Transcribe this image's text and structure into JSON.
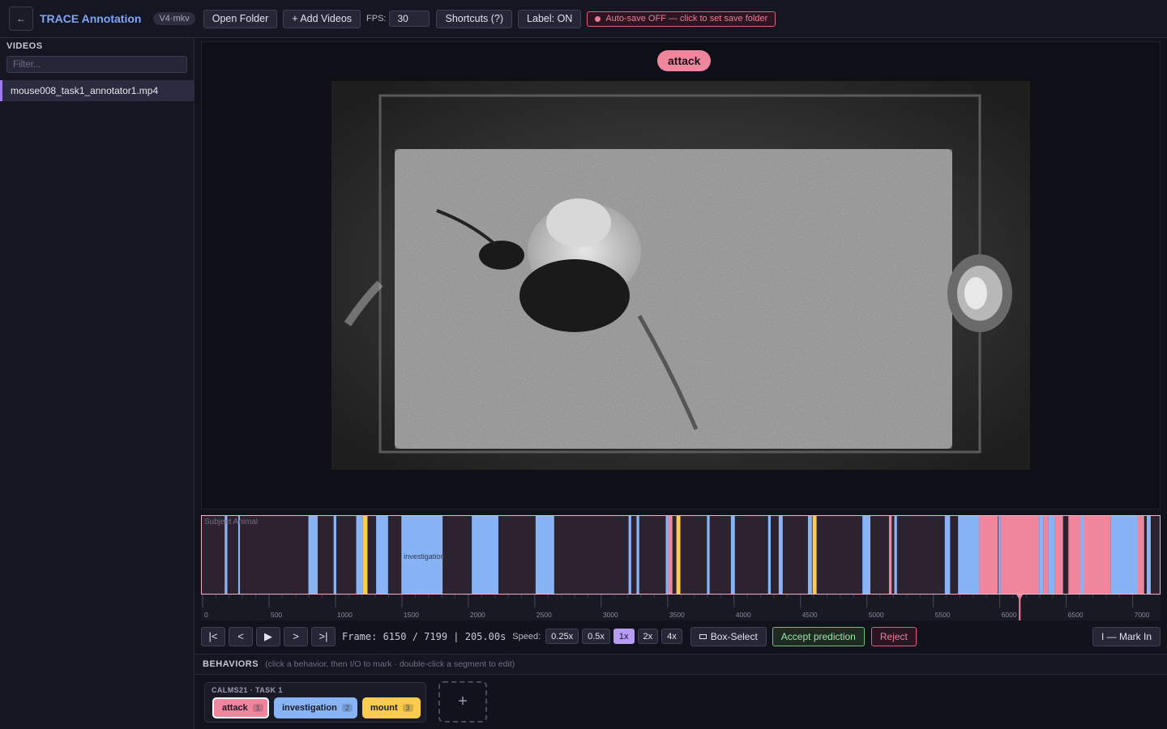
{
  "header": {
    "back_icon": "arrow-left-icon",
    "title": "TRACE Annotation",
    "version": "V4·mkv",
    "open_folder": "Open Folder",
    "add_videos": "+ Add Videos",
    "fps_label": "FPS:",
    "fps_value": "30",
    "shortcuts": "Shortcuts (?)",
    "label_toggle": "Label: ON",
    "autosave": "Auto-save OFF — click to set save folder"
  },
  "sidebar": {
    "heading": "VIDEOS",
    "filter_placeholder": "Filter...",
    "videos": [
      "mouse008_task1_annotator1.mp4"
    ]
  },
  "viewer": {
    "current_behavior": "attack"
  },
  "timeline": {
    "track_label": "Subject Animal",
    "total_frames": 7199,
    "current_frame": 6150,
    "segment_text": "investigation",
    "tick_labels": [
      "0",
      "500",
      "1000",
      "1500",
      "2000",
      "2500",
      "3000",
      "3500",
      "4000",
      "4500",
      "5000",
      "5500",
      "6000",
      "6500",
      "7000"
    ],
    "colors": {
      "attack": "#f0859e",
      "investigation": "#88b4f5",
      "mount": "#fbcb4e",
      "background": "#2c2230"
    },
    "segments": [
      {
        "b": "investigation",
        "s": 160,
        "e": 180
      },
      {
        "b": "investigation",
        "s": 262,
        "e": 275
      },
      {
        "b": "investigation",
        "s": 790,
        "e": 860
      },
      {
        "b": "investigation",
        "s": 980,
        "e": 1000
      },
      {
        "b": "investigation",
        "s": 1150,
        "e": 1200
      },
      {
        "b": "mount",
        "s": 1200,
        "e": 1235
      },
      {
        "b": "investigation",
        "s": 1300,
        "e": 1390
      },
      {
        "b": "investigation",
        "s": 1490,
        "e": 1800
      },
      {
        "b": "investigation",
        "s": 2020,
        "e": 2220
      },
      {
        "b": "investigation",
        "s": 2500,
        "e": 2640
      },
      {
        "b": "investigation",
        "s": 3200,
        "e": 3220
      },
      {
        "b": "investigation",
        "s": 3260,
        "e": 3280
      },
      {
        "b": "investigation",
        "s": 3480,
        "e": 3500
      },
      {
        "b": "attack",
        "s": 3500,
        "e": 3530
      },
      {
        "b": "mount",
        "s": 3560,
        "e": 3590
      },
      {
        "b": "investigation",
        "s": 3790,
        "e": 3810
      },
      {
        "b": "investigation",
        "s": 3970,
        "e": 4000
      },
      {
        "b": "investigation",
        "s": 4250,
        "e": 4270
      },
      {
        "b": "investigation",
        "s": 4330,
        "e": 4360
      },
      {
        "b": "investigation",
        "s": 4550,
        "e": 4580
      },
      {
        "b": "mount",
        "s": 4585,
        "e": 4615
      },
      {
        "b": "investigation",
        "s": 4960,
        "e": 5020
      },
      {
        "b": "attack",
        "s": 5160,
        "e": 5180
      },
      {
        "b": "investigation",
        "s": 5200,
        "e": 5220
      },
      {
        "b": "investigation",
        "s": 5580,
        "e": 5620
      },
      {
        "b": "investigation",
        "s": 5680,
        "e": 5840
      },
      {
        "b": "attack",
        "s": 5840,
        "e": 5980
      },
      {
        "b": "investigation",
        "s": 5985,
        "e": 6000
      },
      {
        "b": "attack",
        "s": 6000,
        "e": 6290
      },
      {
        "b": "investigation",
        "s": 6290,
        "e": 6320
      },
      {
        "b": "attack",
        "s": 6320,
        "e": 6360
      },
      {
        "b": "investigation",
        "s": 6360,
        "e": 6410
      },
      {
        "b": "attack",
        "s": 6410,
        "e": 6470
      },
      {
        "b": "attack",
        "s": 6510,
        "e": 6600
      },
      {
        "b": "investigation",
        "s": 6600,
        "e": 6630
      },
      {
        "b": "attack",
        "s": 6630,
        "e": 6830
      },
      {
        "b": "investigation",
        "s": 6830,
        "e": 7030
      },
      {
        "b": "attack",
        "s": 7030,
        "e": 7080
      },
      {
        "b": "investigation",
        "s": 7100,
        "e": 7130
      }
    ]
  },
  "controls": {
    "first": "|<",
    "prev": "<",
    "play": "▶",
    "next": ">",
    "last": ">|",
    "frame_readout": "Frame: 6150 / 7199 | 205.00s",
    "speed_label": "Speed:",
    "speeds": [
      "0.25x",
      "0.5x",
      "1x",
      "2x",
      "4x"
    ],
    "active_speed": "1x",
    "box_select": "Box-Select",
    "accept": "Accept prediction",
    "reject": "Reject",
    "mark_in": "I — Mark In"
  },
  "behaviors": {
    "heading": "BEHAVIORS",
    "hint": "(click a behavior, then I/O to mark · double-click a segment to edit)",
    "group_name": "CALMS21 · TASK 1",
    "items": [
      {
        "name": "attack",
        "key": "1"
      },
      {
        "name": "investigation",
        "key": "2"
      },
      {
        "name": "mount",
        "key": "3"
      }
    ],
    "add_label": "+"
  }
}
